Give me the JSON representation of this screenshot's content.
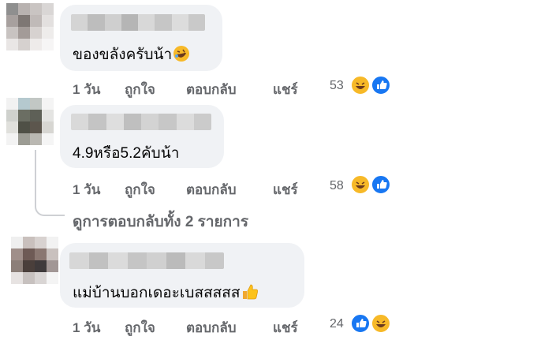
{
  "comments": [
    {
      "text": "ของขลังครับน้า",
      "emoji_icon": "rolling-laughing-icon",
      "time": "1 วัน",
      "like_label": "ถูกใจ",
      "reply_label": "ตอบกลับ",
      "share_label": "แชร์",
      "reaction_count": "53",
      "reactions": [
        "haha-icon",
        "like-icon"
      ]
    },
    {
      "text": "4.9หรือ5.2คับน้า",
      "time": "1 วัน",
      "like_label": "ถูกใจ",
      "reply_label": "ตอบกลับ",
      "share_label": "แชร์",
      "reaction_count": "58",
      "reactions": [
        "haha-icon",
        "like-icon"
      ]
    },
    {
      "text": "แม่บ้านบอกเดอะเบสสสสส",
      "emoji_icon": "thumbs-up-emoji-icon",
      "time": "1 วัน",
      "like_label": "ถูกใจ",
      "reply_label": "ตอบกลับ",
      "share_label": "แชร์",
      "reaction_count": "24",
      "reactions": [
        "like-icon",
        "haha-icon"
      ]
    }
  ],
  "view_replies": "ดูการตอบกลับทั้ง 2 รายการ",
  "colors": {
    "bubble": "#f0f2f5",
    "meta_text": "#65676b",
    "like_blue": "#1877f2",
    "haha_yellow": "#f7b928"
  }
}
